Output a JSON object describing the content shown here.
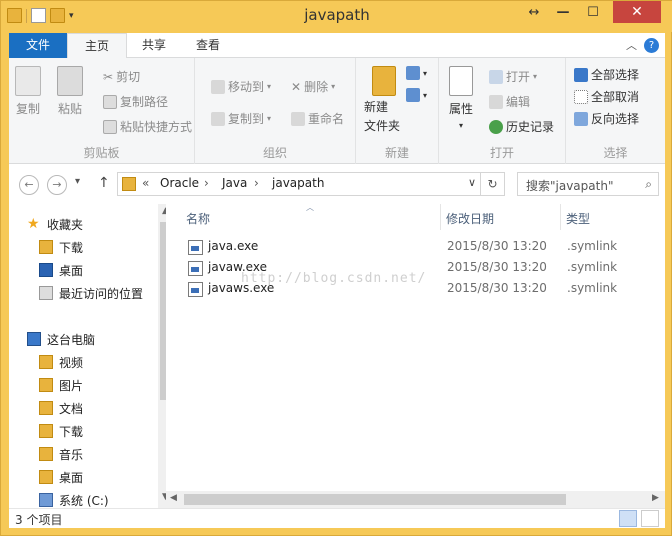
{
  "window": {
    "title": "javapath",
    "controls": {
      "resize": "↔",
      "minimize": "—",
      "maximize": "☐",
      "close": "✕"
    }
  },
  "ribbon_tabs": [
    {
      "label": "文件",
      "active": false
    },
    {
      "label": "主页",
      "active": true
    },
    {
      "label": "共享",
      "active": false
    },
    {
      "label": "查看",
      "active": false
    }
  ],
  "ribbon": {
    "clipboard": {
      "label": "剪贴板",
      "copy": "复制",
      "paste": "粘贴",
      "cut": "剪切",
      "copy_path": "复制路径",
      "paste_shortcut": "粘贴快捷方式"
    },
    "organize": {
      "label": "组织",
      "move_to": "移动到",
      "copy_to": "复制到",
      "delete": "删除",
      "rename": "重命名"
    },
    "new": {
      "label": "新建",
      "new_folder_line1": "新建",
      "new_folder_line2": "文件夹"
    },
    "open": {
      "label": "打开",
      "properties": "属性",
      "open": "打开",
      "edit": "编辑",
      "history": "历史记录"
    },
    "select": {
      "label": "选择",
      "select_all": "全部选择",
      "select_none": "全部取消",
      "invert": "反向选择"
    }
  },
  "address": {
    "overflow": "«",
    "crumbs": [
      "Oracle",
      "Java",
      "javapath"
    ],
    "search_placeholder": "搜索\"javapath\""
  },
  "nav_pane": {
    "favorites_header": "收藏夹",
    "favorites": [
      "下载",
      "桌面",
      "最近访问的位置"
    ],
    "pc_header": "这台电脑",
    "pc_items": [
      "视频",
      "图片",
      "文档",
      "下载",
      "音乐",
      "桌面",
      "系统 (C:)"
    ]
  },
  "columns": {
    "name": "名称",
    "date": "修改日期",
    "type": "类型"
  },
  "files": [
    {
      "name": "java.exe",
      "date": "2015/8/30 13:20",
      "type": ".symlink"
    },
    {
      "name": "javaw.exe",
      "date": "2015/8/30 13:20",
      "type": ".symlink"
    },
    {
      "name": "javaws.exe",
      "date": "2015/8/30 13:20",
      "type": ".symlink"
    }
  ],
  "watermark": "http://blog.csdn.net/",
  "status": {
    "item_count": "3 个项目"
  },
  "colors": {
    "title_bar": "#f6c957",
    "file_tab": "#1a6fc2",
    "close_button": "#c7453e"
  }
}
